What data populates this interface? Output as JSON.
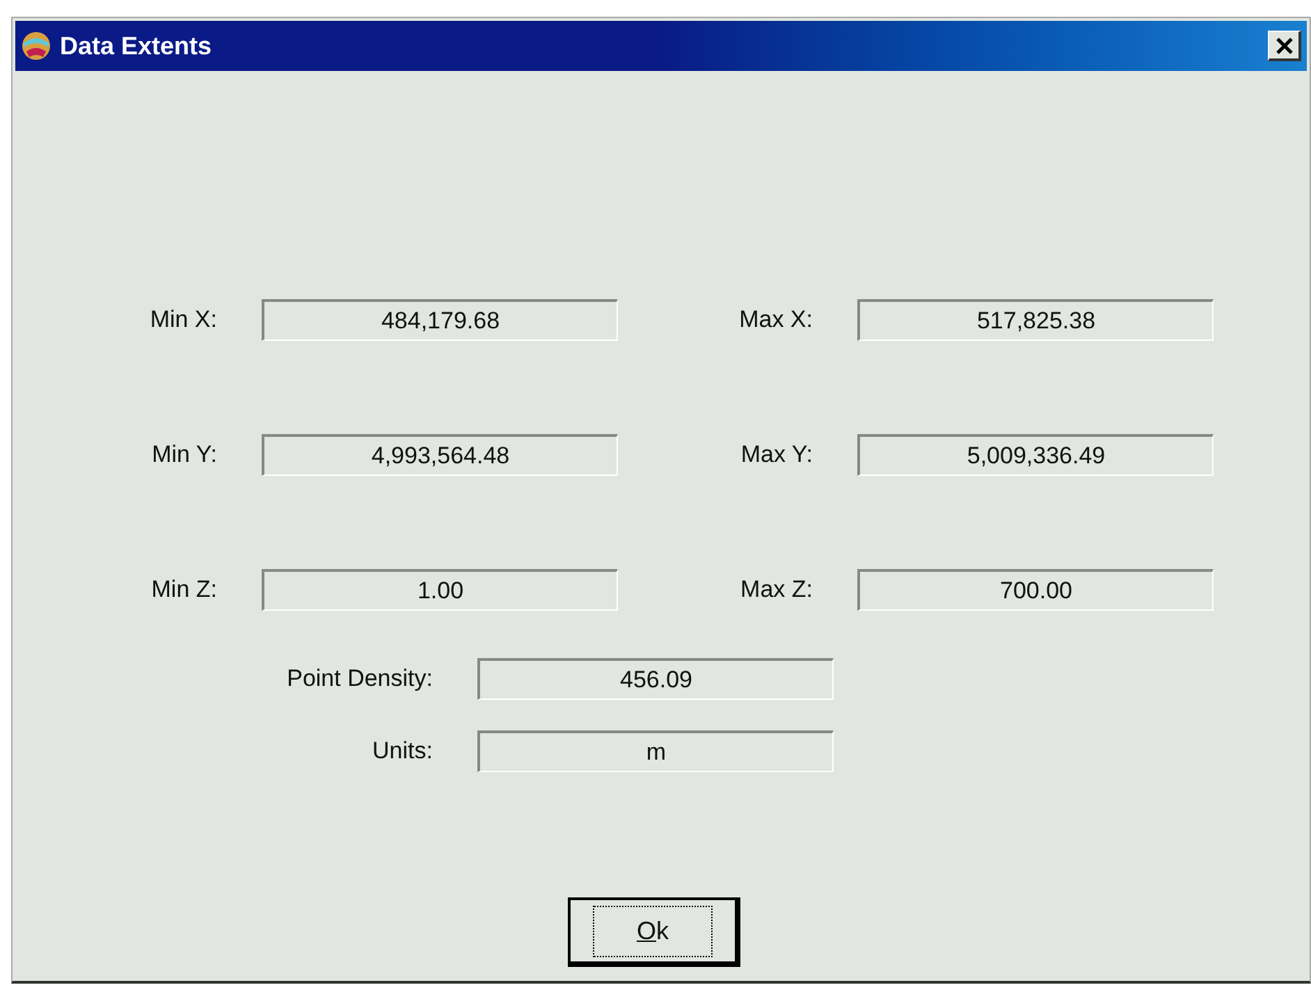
{
  "window": {
    "title": "Data Extents"
  },
  "extents": [
    {
      "label": "Min X:",
      "value": "484,179.68"
    },
    {
      "label": "Max X:",
      "value": "517,825.38"
    },
    {
      "label": "Min Y:",
      "value": "4,993,564.48"
    },
    {
      "label": "Max Y:",
      "value": "5,009,336.49"
    },
    {
      "label": "Min Z:",
      "value": "1.00"
    },
    {
      "label": "Max Z:",
      "value": "700.00"
    }
  ],
  "summary": [
    {
      "label": "Point Density:",
      "value": "456.09"
    },
    {
      "label": "Units:",
      "value": "m"
    }
  ],
  "buttons": [
    {
      "label": "Ok",
      "focused": true
    }
  ]
}
